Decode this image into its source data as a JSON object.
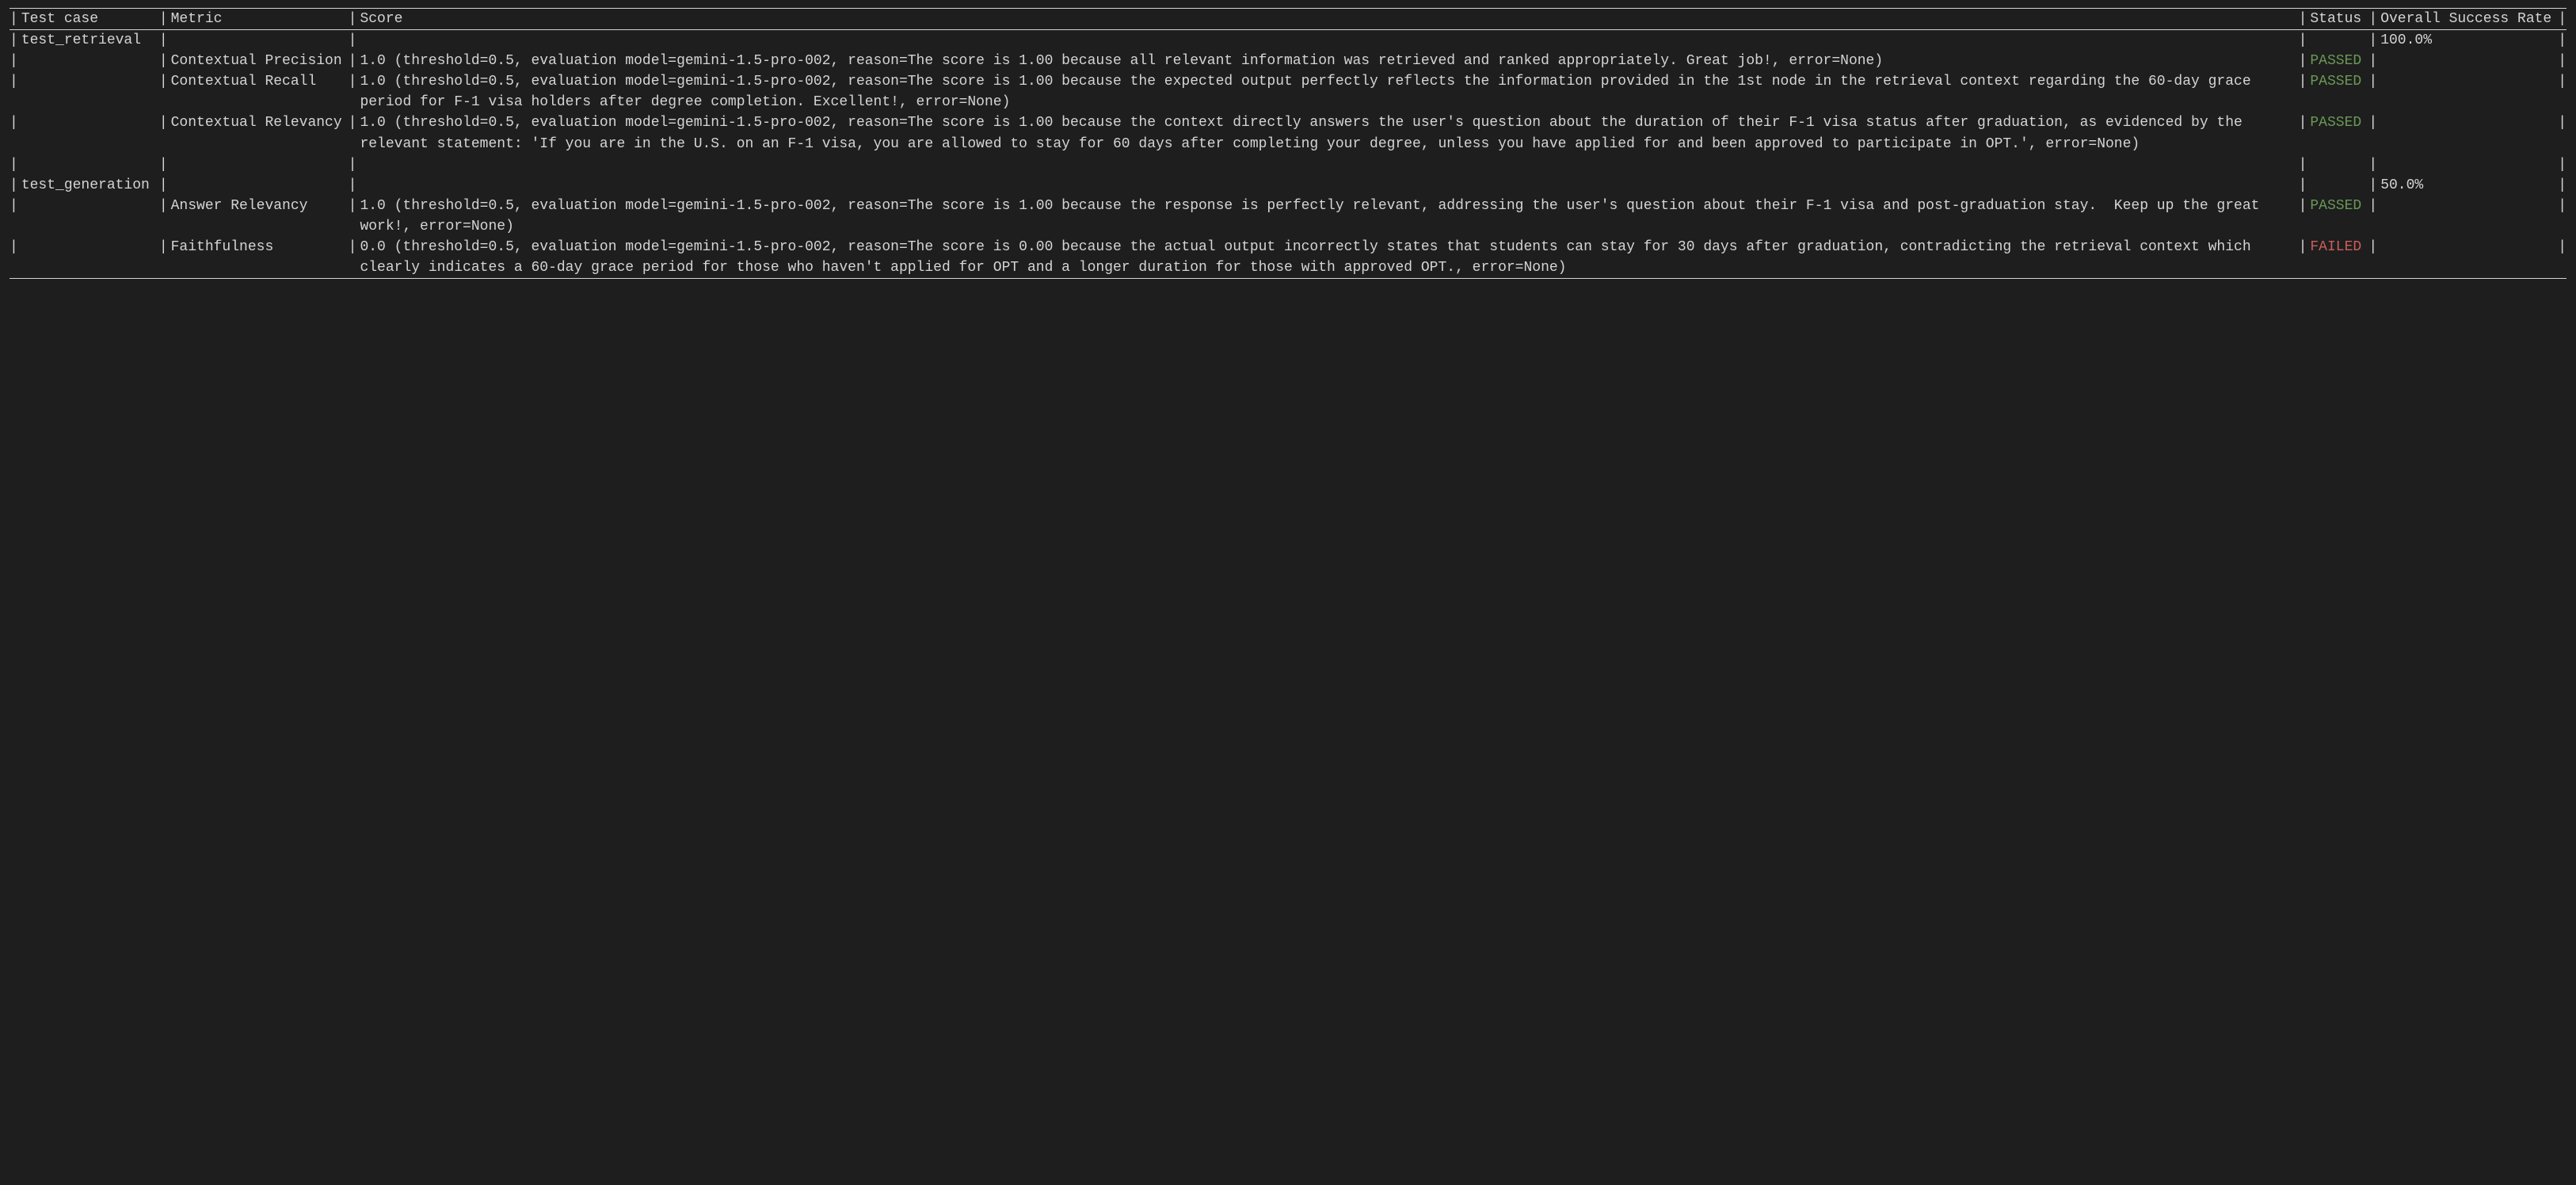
{
  "headers": {
    "testcase": "Test case",
    "metric": "Metric",
    "score": "Score",
    "status": "Status",
    "rate": "Overall Success Rate"
  },
  "colors": {
    "passed": "#6a9955",
    "failed": "#ce5c5c",
    "text": "#d4d4d4",
    "background": "#1e1e1e"
  },
  "groups": [
    {
      "testcase": "test_retrieval",
      "overall_rate": "100.0%",
      "rows": [
        {
          "metric": "Contextual Precision",
          "score": "1.0 (threshold=0.5, evaluation model=gemini-1.5-pro-002, reason=The score is 1.00 because all relevant information was retrieved and ranked appropriately. Great job!, error=None)",
          "status": "PASSED"
        },
        {
          "metric": "Contextual Recall",
          "score": "1.0 (threshold=0.5, evaluation model=gemini-1.5-pro-002, reason=The score is 1.00 because the expected output perfectly reflects the information provided in the 1st node in the retrieval context regarding the 60-day grace period for F-1 visa holders after degree completion. Excellent!, error=None)",
          "status": "PASSED"
        },
        {
          "metric": "Contextual Relevancy",
          "score": "1.0 (threshold=0.5, evaluation model=gemini-1.5-pro-002, reason=The score is 1.00 because the context directly answers the user's question about the duration of their F-1 visa status after graduation, as evidenced by the relevant statement: 'If you are in the U.S. on an F-1 visa, you are allowed to stay for 60 days after completing your degree, unless you have applied for and been approved to participate in OPT.', error=None)",
          "status": "PASSED"
        }
      ]
    },
    {
      "testcase": "test_generation",
      "overall_rate": "50.0%",
      "rows": [
        {
          "metric": "Answer Relevancy",
          "score": "1.0 (threshold=0.5, evaluation model=gemini-1.5-pro-002, reason=The score is 1.00 because the response is perfectly relevant, addressing the user's question about their F-1 visa and post-graduation stay.  Keep up the great work!, error=None)",
          "status": "PASSED"
        },
        {
          "metric": "Faithfulness",
          "score": "0.0 (threshold=0.5, evaluation model=gemini-1.5-pro-002, reason=The score is 0.00 because the actual output incorrectly states that students can stay for 30 days after graduation, contradicting the retrieval context which clearly indicates a 60-day grace period for those who haven't applied for OPT and a longer duration for those with approved OPT., error=None)",
          "status": "FAILED"
        }
      ]
    }
  ]
}
